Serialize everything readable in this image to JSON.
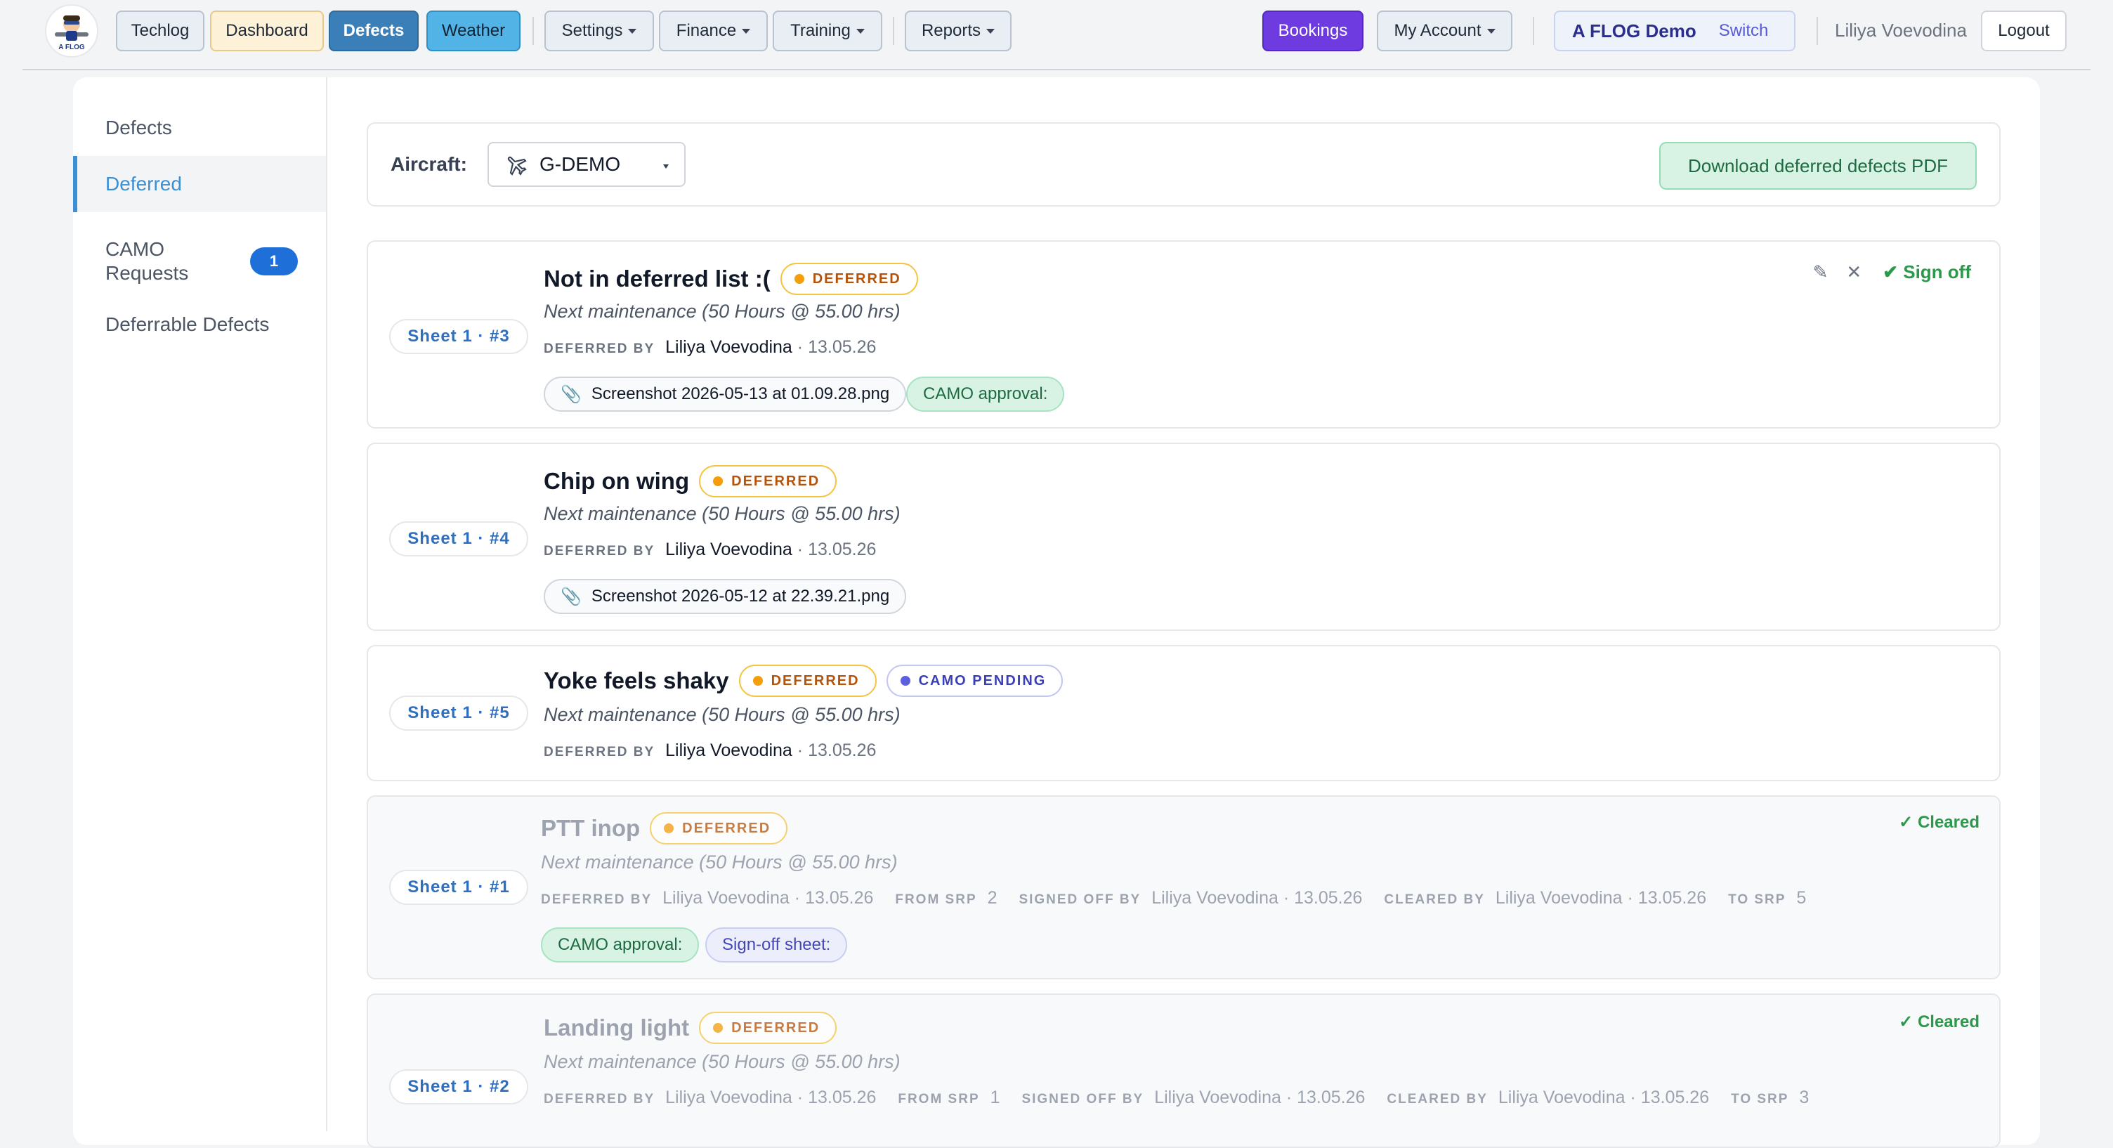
{
  "nav": {
    "logo_text": "A FLOG",
    "buttons": {
      "techlog": "Techlog",
      "dashboard": "Dashboard",
      "defects": "Defects",
      "weather": "Weather",
      "settings": "Settings",
      "finance": "Finance",
      "training": "Training",
      "reports": "Reports",
      "bookings": "Bookings",
      "my_account": "My Account"
    },
    "org_name": "A FLOG Demo",
    "switch_label": "Switch",
    "user_name": "Liliya Voevodina",
    "logout_label": "Logout",
    "colors": {
      "defects_active": "#3a7fb8",
      "weather": "#52b4e6",
      "bookings": "#6d3be0",
      "dashboard": "#fdf1d8"
    }
  },
  "sidebar": {
    "items": [
      {
        "label": "Defects"
      },
      {
        "label": "Deferred"
      },
      {
        "label": "CAMO Requests",
        "badge": "1"
      },
      {
        "label": "Deferrable Defects"
      }
    ]
  },
  "aircraft_bar": {
    "label": "Aircraft:",
    "selected": "G-DEMO",
    "pdf_button": "Download deferred defects PDF"
  },
  "defects": [
    {
      "sheet": "Sheet 1 · #3",
      "title": "Not in deferred list :(",
      "badges": [
        "DEFERRED"
      ],
      "next": "Next maintenance (50 Hours @ 55.00 hrs)",
      "deferred_by_label": "DEFERRED BY",
      "deferred_by": "Liliya Voevodina",
      "deferred_date": "· 13.05.26",
      "file": "Screenshot 2026-05-13 at 01.09.28.png",
      "camo_chip": "CAMO approval:",
      "action_signoff": "Sign off"
    },
    {
      "sheet": "Sheet 1 · #4",
      "title": "Chip on wing",
      "badges": [
        "DEFERRED"
      ],
      "next": "Next maintenance (50 Hours @ 55.00 hrs)",
      "deferred_by_label": "DEFERRED BY",
      "deferred_by": "Liliya Voevodina",
      "deferred_date": "· 13.05.26",
      "file": "Screenshot 2026-05-12 at 22.39.21.png"
    },
    {
      "sheet": "Sheet 1 · #5",
      "title": "Yoke feels shaky",
      "badges": [
        "DEFERRED",
        "CAMO PENDING"
      ],
      "next": "Next maintenance (50 Hours @ 55.00 hrs)",
      "deferred_by_label": "DEFERRED BY",
      "deferred_by": "Liliya Voevodina",
      "deferred_date": "· 13.05.26"
    },
    {
      "sheet": "Sheet 1 · #1",
      "title": "PTT inop",
      "badges": [
        "DEFERRED"
      ],
      "status": "✓ Cleared",
      "next": "Next maintenance (50 Hours @ 55.00 hrs)",
      "deferred_by_label": "DEFERRED BY",
      "deferred_by": "Liliya Voevodina",
      "deferred_date": "· 13.05.26",
      "from_srp_label": "FROM SRP",
      "from_srp": "2",
      "signed_off_label": "SIGNED OFF BY",
      "signed_off_by": "Liliya Voevodina",
      "signed_off_date": "· 13.05.26",
      "cleared_by_label": "CLEARED BY",
      "cleared_by": "Liliya Voevodina",
      "cleared_date": "· 13.05.26",
      "to_srp_label": "TO SRP",
      "to_srp": "5",
      "camo_chip": "CAMO approval:",
      "signoff_chip": "Sign-off sheet:"
    },
    {
      "sheet": "Sheet 1 · #2",
      "title": "Landing light",
      "badges": [
        "DEFERRED"
      ],
      "status": "✓ Cleared",
      "next": "Next maintenance (50 Hours @ 55.00 hrs)",
      "deferred_by_label": "DEFERRED BY",
      "deferred_by": "Liliya Voevodina",
      "deferred_date": "· 13.05.26",
      "from_srp_label": "FROM SRP",
      "from_srp": "1",
      "signed_off_label": "SIGNED OFF BY",
      "signed_off_by": "Liliya Voevodina",
      "signed_off_date": "· 13.05.26",
      "cleared_by_label": "CLEARED BY",
      "cleared_by": "Liliya Voevodina",
      "cleared_date": "· 13.05.26",
      "to_srp_label": "TO SRP",
      "to_srp": "3"
    }
  ]
}
